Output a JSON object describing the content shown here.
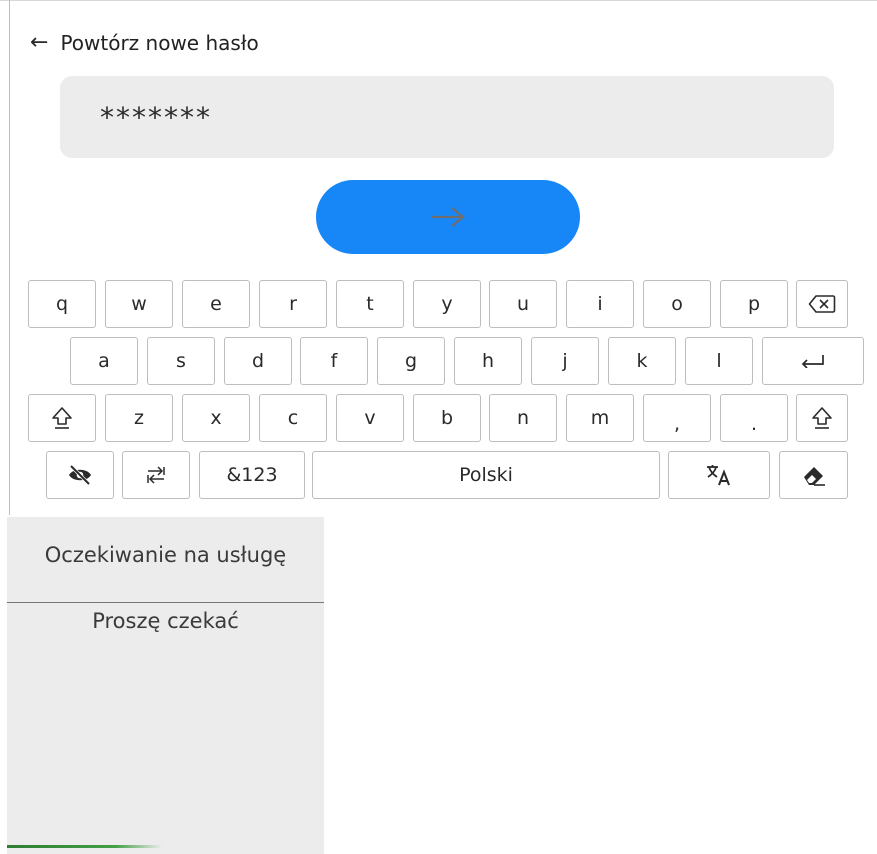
{
  "header": {
    "back_icon": "←",
    "title": "Powtórz nowe hasło"
  },
  "password": {
    "value": "*******",
    "masked": true
  },
  "confirm": {
    "icon": "arrow-right-icon",
    "color": "#1787f7"
  },
  "keyboard": {
    "row1": [
      "q",
      "w",
      "e",
      "r",
      "t",
      "y",
      "u",
      "i",
      "o",
      "p"
    ],
    "row2": [
      "a",
      "s",
      "d",
      "f",
      "g",
      "h",
      "j",
      "k",
      "l"
    ],
    "row3": [
      "z",
      "x",
      "c",
      "v",
      "b",
      "n",
      "m",
      ",",
      "."
    ],
    "symbols_label": "&123",
    "language_label": "Polski",
    "icons": [
      "backspace-icon",
      "enter-icon",
      "shift-icon",
      "hide-password-icon",
      "switch-icon",
      "translate-icon",
      "eraser-icon"
    ]
  },
  "wait_panel": {
    "title": "Oczekiwanie na usługę",
    "message": "Proszę czekać",
    "progress_color": "#43a047"
  }
}
